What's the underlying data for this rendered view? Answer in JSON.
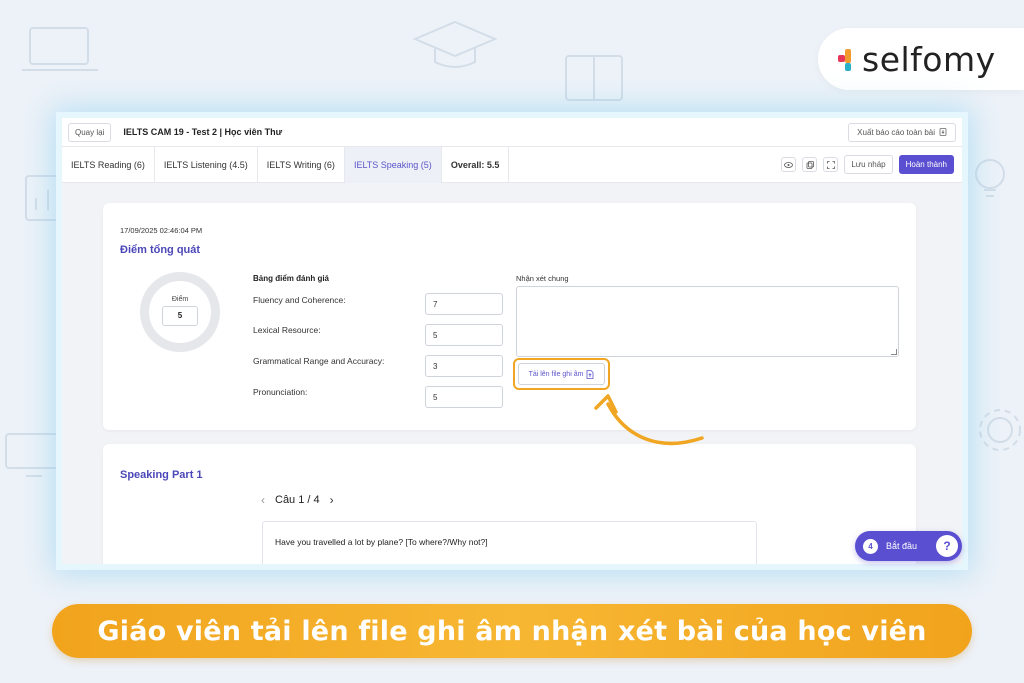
{
  "brand": {
    "name": "selfomy"
  },
  "topbar": {
    "back_label": "Quay lại",
    "title": "IELTS CAM 19 - Test 2 | Học viên Thư",
    "export_label": "Xuất báo cáo toàn bài"
  },
  "tabs": [
    {
      "label": "IELTS Reading (6)"
    },
    {
      "label": "IELTS Listening (4.5)"
    },
    {
      "label": "IELTS Writing (6)"
    },
    {
      "label": "IELTS Speaking (5)",
      "active": true
    },
    {
      "label": "Overall: 5.5"
    }
  ],
  "toolbar": {
    "view_icon": "eye-icon",
    "copy_icon": "copy-icon",
    "fullscreen_icon": "fullscreen-icon",
    "draft_label": "Lưu nháp",
    "done_label": "Hoàn thành"
  },
  "summary": {
    "timestamp": "17/09/2025 02:46:04 PM",
    "title": "Điểm tổng quát",
    "score_label": "Điểm",
    "score_value": "5",
    "criteria_title": "Bảng điểm đánh giá",
    "criteria": [
      {
        "label": "Fluency and Coherence:",
        "value": "7"
      },
      {
        "label": "Lexical Resource:",
        "value": "5"
      },
      {
        "label": "Grammatical Range and Accuracy:",
        "value": "3"
      },
      {
        "label": "Pronunciation:",
        "value": "5"
      }
    ],
    "comment_label": "Nhận xét chung",
    "comment_value": "",
    "upload_label": "Tải lên file ghi âm"
  },
  "speaking": {
    "part_title": "Speaking Part 1",
    "pager": "Câu 1 / 4",
    "question": "Have you travelled a lot by plane? [To where?/Why not?]"
  },
  "start_button": {
    "count": "4",
    "label": "Bắt đầu"
  },
  "caption": "Giáo viên tải lên file ghi âm nhận xét bài của học viên",
  "colors": {
    "accent": "#5a4fd1",
    "highlight": "#f0a622",
    "title": "#4b47b8"
  }
}
